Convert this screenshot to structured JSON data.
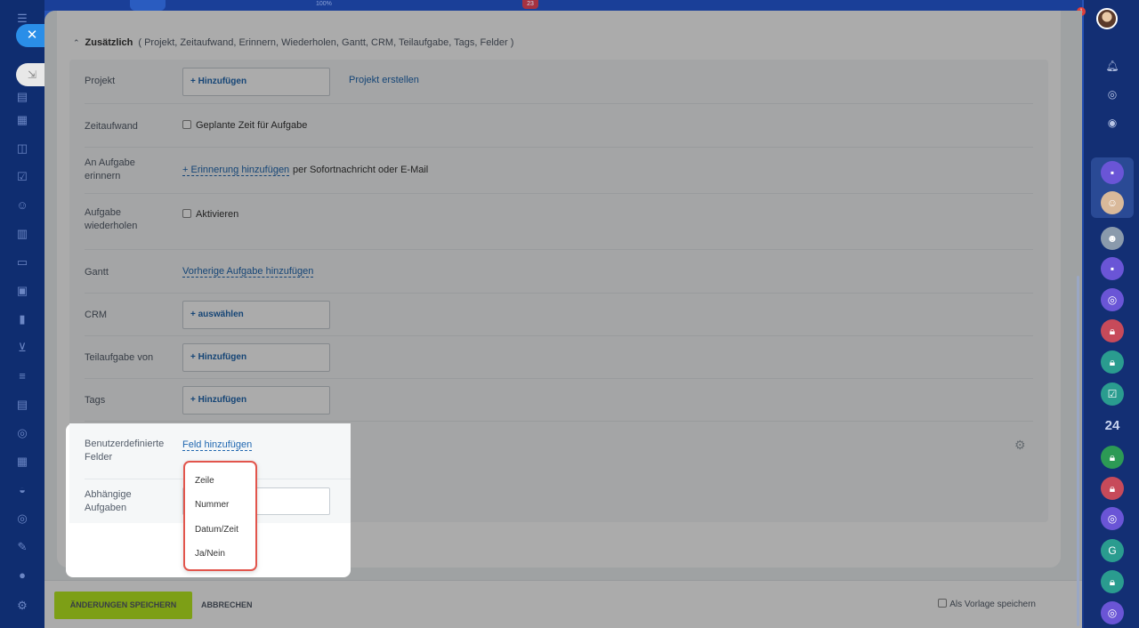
{
  "top": {
    "zoom_text": "100%",
    "badge_count": "23",
    "notification_count": "1"
  },
  "sidebar_left": {
    "icons": [
      "menu-icon",
      "home-icon",
      "feed-icon",
      "chat-icon",
      "tasks-icon",
      "contacts-icon",
      "documents-icon",
      "drive-icon",
      "sites-icon",
      "analytics-icon",
      "shop-icon",
      "filter-icon",
      "crm-icon",
      "automation-icon",
      "calendar-icon",
      "market-icon",
      "marketing-icon",
      "edit-icon",
      "user-icon",
      "settings-icon"
    ]
  },
  "section": {
    "title": "Zusätzlich",
    "subtitle": "( Projekt,  Zeitaufwand,  Erinnern,  Wiederholen,  Gantt,  CRM,  Teilaufgabe,  Tags,  Felder )"
  },
  "rows": {
    "projekt": {
      "label": "Projekt",
      "button": "+ Hinzufügen",
      "link": "Projekt erstellen"
    },
    "zeitaufwand": {
      "label": "Zeitaufwand",
      "checkbox": "Geplante Zeit für Aufgabe"
    },
    "erinnern": {
      "label": "An Aufgabe erinnern",
      "link": "+ Erinnerung hinzufügen",
      "suffix": "per Sofortnachricht oder E-Mail"
    },
    "wiederholen": {
      "label": "Aufgabe wiederholen",
      "checkbox": "Aktivieren"
    },
    "gantt": {
      "label": "Gantt",
      "link": "Vorherige Aufgabe hinzufügen"
    },
    "crm": {
      "label": "CRM",
      "button": "+ auswählen"
    },
    "teilaufgabe": {
      "label": "Teilaufgabe von",
      "button": "+ Hinzufügen"
    },
    "tags": {
      "label": "Tags",
      "button": "+ Hinzufügen"
    },
    "felder": {
      "label": "Benutzerdefinierte Felder",
      "link": "Feld hinzufügen"
    },
    "abhaengig": {
      "label": "Abhängige Aufgaben"
    }
  },
  "dropdown": {
    "items": [
      "Zeile",
      "Nummer",
      "Datum/Zeit",
      "Ja/Nein"
    ]
  },
  "footer": {
    "save": "ÄNDERUNGEN SPEICHERN",
    "cancel": "ABBRECHEN",
    "template": "Als Vorlage speichern"
  },
  "sidebar_right": {
    "number": "24",
    "letter": "G"
  },
  "colors": {
    "accent_green": "#bbed21",
    "link_blue": "#2067b0",
    "highlight_red": "#e2554c"
  }
}
